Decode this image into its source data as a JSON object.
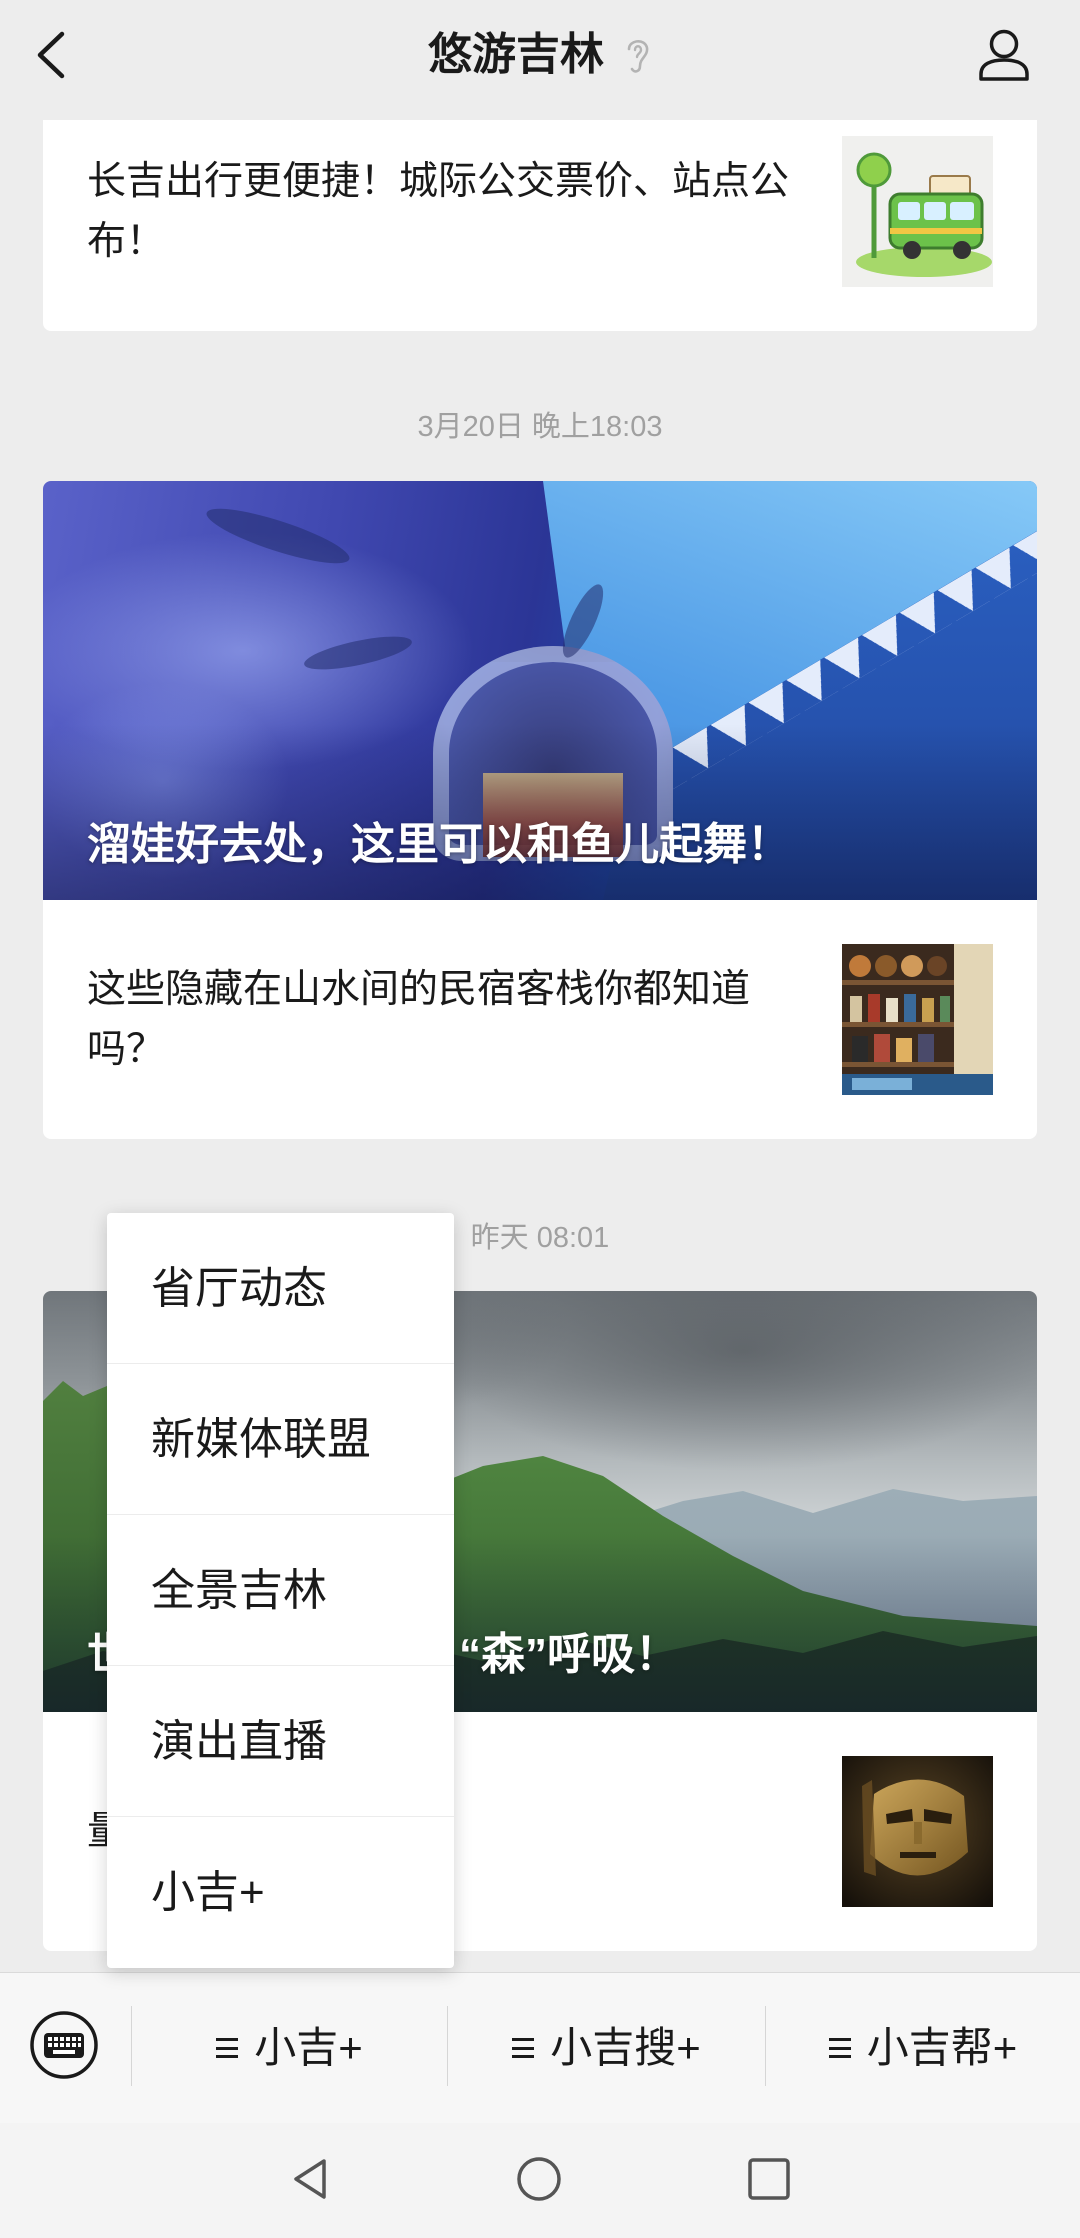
{
  "header": {
    "back_icon": "chevron-left-icon",
    "title": "悠游吉林",
    "ear_icon": "ear-icon",
    "profile_icon": "person-icon"
  },
  "messages": [
    {
      "articles": [
        {
          "title": "长吉出行更便捷！城际公交票价、站点公布！"
        }
      ]
    },
    {
      "timestamp": "3月20日 晚上18:03",
      "cover_title": "溜娃好去处，这里可以和鱼儿起舞！",
      "articles": [
        {
          "title": "这些隐藏在山水间的民宿客栈你都知道吗？"
        }
      ]
    },
    {
      "timestamp": "昨天 08:01",
      "cover_title_visible_start": "世",
      "cover_title_visible_end": "“森”呼吸！",
      "articles": [
        {
          "title_visible_start": "量"
        }
      ]
    }
  ],
  "popup_menu": {
    "items": [
      "省厅动态",
      "新媒体联盟",
      "全景吉林",
      "演出直播",
      "小吉+"
    ]
  },
  "menu_bar": {
    "keyboard_icon": "keyboard-icon",
    "items": [
      {
        "icon": "menu-lines-icon",
        "label": "小吉+"
      },
      {
        "icon": "menu-lines-icon",
        "label": "小吉搜+"
      },
      {
        "icon": "menu-lines-icon",
        "label": "小吉帮+"
      }
    ]
  },
  "system_nav": {
    "back_icon": "triangle-back-icon",
    "home_icon": "circle-home-icon",
    "recents_icon": "square-recents-icon"
  },
  "colors": {
    "page_background": "#ededed",
    "card_background": "#ffffff",
    "text": "#1a1a1a",
    "timestamp": "#a0a0a0",
    "menu_bar_background": "#f7f7f7",
    "banner_title": "#ffffff"
  }
}
